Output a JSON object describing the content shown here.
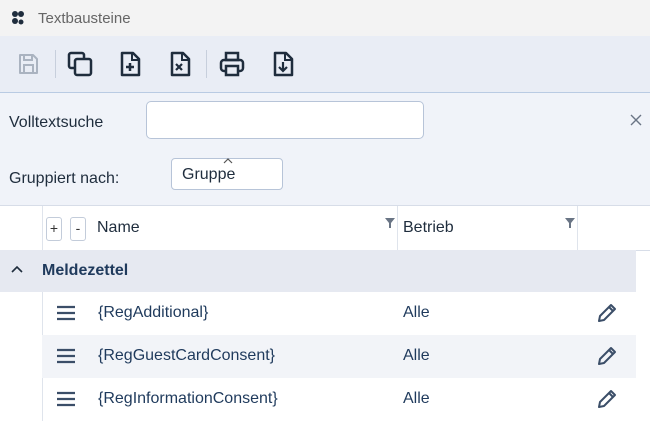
{
  "window": {
    "title": "Textbausteine",
    "app_icon": "app-dots-icon"
  },
  "toolbar": {
    "buttons": [
      {
        "name": "save-button",
        "icon": "floppy-icon",
        "enabled": false
      },
      {
        "name": "copy-button",
        "icon": "copy-icon",
        "enabled": true
      },
      {
        "name": "new-document-button",
        "icon": "document-plus-icon",
        "enabled": true
      },
      {
        "name": "delete-document-button",
        "icon": "document-x-icon",
        "enabled": true
      },
      {
        "name": "print-button",
        "icon": "printer-icon",
        "enabled": true
      },
      {
        "name": "download-button",
        "icon": "document-download-icon",
        "enabled": true
      }
    ]
  },
  "filter": {
    "search_label": "Volltextsuche",
    "search_value": "",
    "group_label": "Gruppiert nach:",
    "group_value": "Gruppe"
  },
  "grid": {
    "expand_all": "+",
    "collapse_all": "-",
    "columns": [
      {
        "label": "Name"
      },
      {
        "label": "Betrieb"
      }
    ],
    "groups": [
      {
        "label": "Meldezettel",
        "rows": [
          {
            "name": "{RegAdditional}",
            "betrieb": "Alle"
          },
          {
            "name": "{RegGuestCardConsent}",
            "betrieb": "Alle"
          },
          {
            "name": "{RegInformationConsent}",
            "betrieb": "Alle"
          }
        ]
      }
    ]
  },
  "colors": {
    "accent": "#1f3a5c",
    "toolbar_bg": "#e9edf5",
    "group_bg": "#e6e9f1"
  }
}
